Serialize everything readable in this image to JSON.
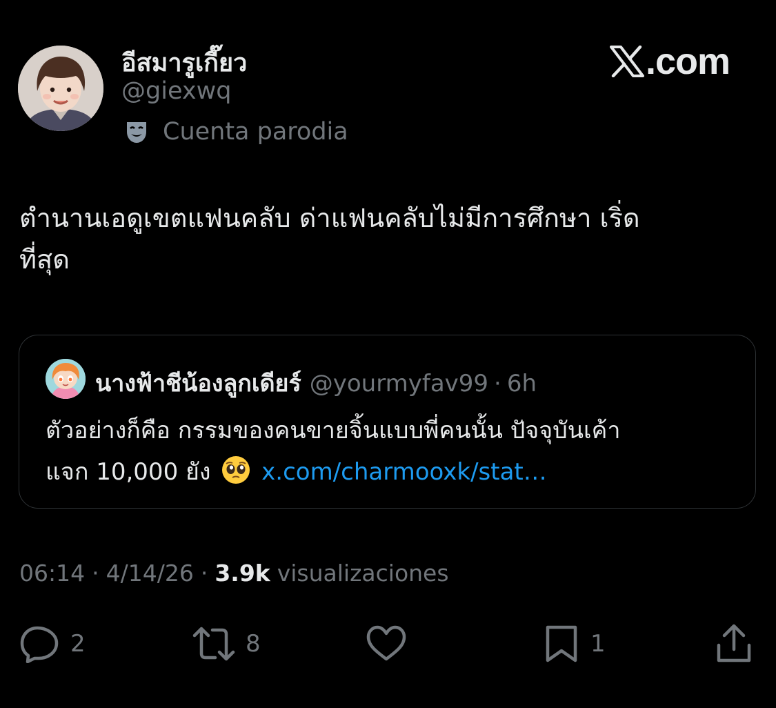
{
  "author": {
    "display_name": "อีสมารูเกี๊ยว",
    "handle": "@giexwq",
    "parody_label": "Cuenta parodia",
    "parody_icon": "theater-mask-icon"
  },
  "brand": {
    "logo_icon": "x-logo-icon",
    "text": ".com"
  },
  "tweet": {
    "line1": "ตำนานเอดูเขตแฟนคลับ ด่าแฟนคลับไม่มีการศึกษา เริ่ด",
    "line2": "ที่สุด"
  },
  "quote": {
    "name": "นางฟ้าชีน้องลูกเดียร์",
    "handle": "@yourmyfav99",
    "separator": "·",
    "time": "6h",
    "line1": "ตัวอย่างก็คือ กรรมของคนขายจิ้นแบบพี่คนนั้น ปัจจุบันเค้า",
    "line2_text": "แจก 10,000 ยัง",
    "emoji": "pleading-face-icon",
    "link": "x.com/charmooxk/stat…"
  },
  "meta": {
    "time": "06:14",
    "separator": "·",
    "date": "4/14/26",
    "views_count": "3.9k",
    "views_label": "visualizaciones"
  },
  "actions": {
    "replies": "2",
    "reposts": "8",
    "likes": "",
    "bookmarks": "1"
  },
  "colors": {
    "background": "#000000",
    "primary_text": "#e7e9ea",
    "secondary_text": "#71767b",
    "link": "#1d9bf0",
    "border": "#2f3336"
  }
}
